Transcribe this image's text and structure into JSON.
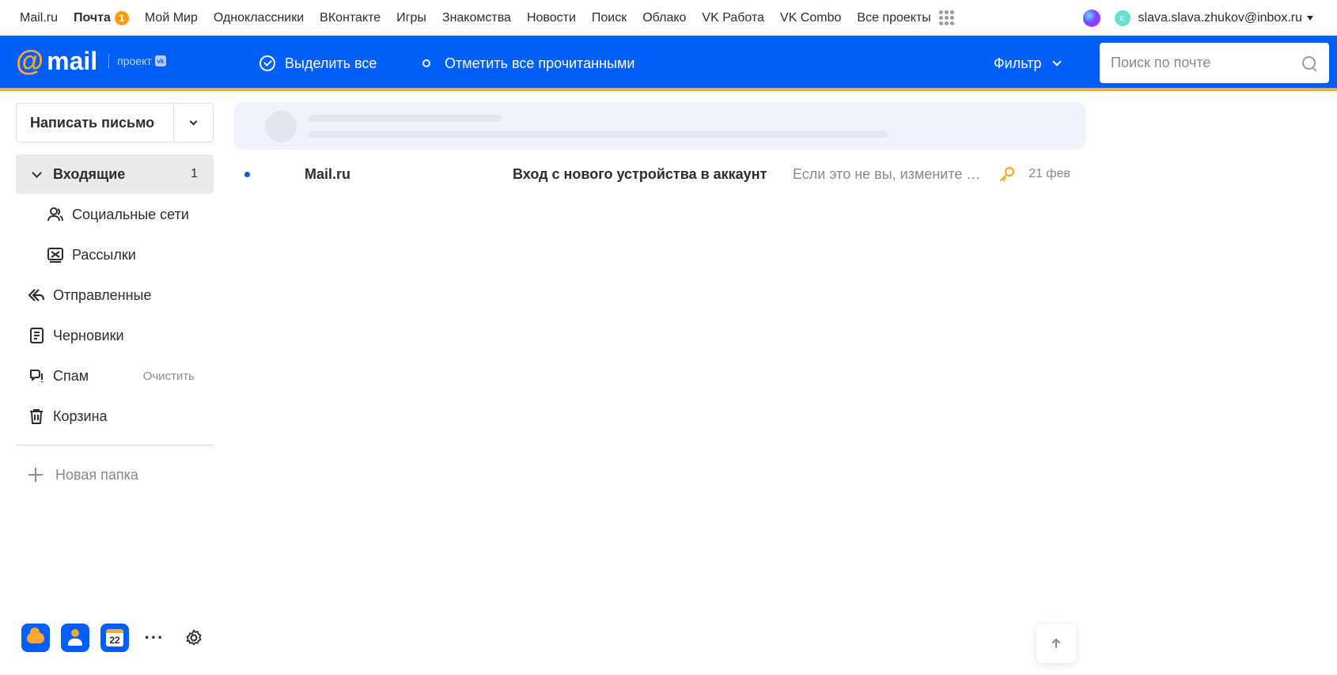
{
  "portal": {
    "links": [
      {
        "label": "Mail.ru"
      },
      {
        "label": "Почта",
        "badge": "1",
        "active": true
      },
      {
        "label": "Мой Мир"
      },
      {
        "label": "Одноклассники"
      },
      {
        "label": "ВКонтакте"
      },
      {
        "label": "Игры"
      },
      {
        "label": "Знакомства"
      },
      {
        "label": "Новости"
      },
      {
        "label": "Поиск"
      },
      {
        "label": "Облако"
      },
      {
        "label": "VK Работа"
      },
      {
        "label": "VK Combo"
      },
      {
        "label": "Все проекты"
      }
    ],
    "avatar_letter": "с",
    "email": "slava.slava.zhukov@inbox.ru"
  },
  "header": {
    "logo_at": "@",
    "logo_mail": "mail",
    "logo_project": "проект",
    "logo_vk": "vk",
    "select_all": "Выделить все",
    "mark_read": "Отметить все прочитанными",
    "filter": "Фильтр",
    "search_placeholder": "Поиск по почте",
    "brand_color": "#005ff9",
    "accent_color": "#ffa930"
  },
  "sidebar": {
    "compose": "Написать письмо",
    "folders": [
      {
        "label": "Входящие",
        "count": "1",
        "icon": "chevron-down-icon"
      },
      {
        "label": "Социальные сети",
        "icon": "social-icon"
      },
      {
        "label": "Рассылки",
        "icon": "newsletter-icon"
      },
      {
        "label": "Отправленные",
        "icon": "sent-icon"
      },
      {
        "label": "Черновики",
        "icon": "drafts-icon"
      },
      {
        "label": "Спам",
        "action": "Очистить",
        "icon": "spam-icon"
      },
      {
        "label": "Корзина",
        "icon": "trash-icon"
      }
    ],
    "new_folder": "Новая папка",
    "apps": [
      {
        "icon": "cloud-icon"
      },
      {
        "icon": "contacts-icon"
      },
      {
        "icon": "calendar-icon",
        "label": "22"
      },
      {
        "icon": "more-icon",
        "label": "···"
      },
      {
        "icon": "settings-icon"
      }
    ]
  },
  "messages": [
    {
      "from": "Mail.ru",
      "subject": "Вход с нового устройства в аккаунт",
      "snippet": "Если это не вы, измените пароль",
      "date": "21 фев",
      "unread": true,
      "icon": "key-icon"
    }
  ]
}
